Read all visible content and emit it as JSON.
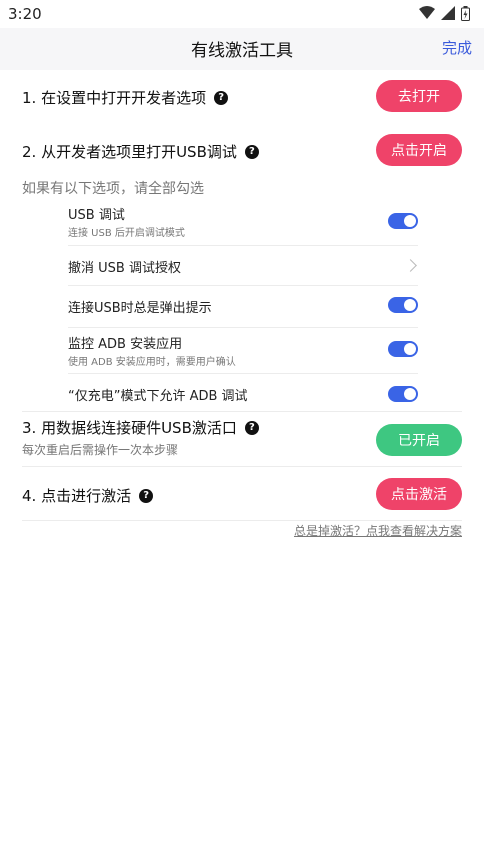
{
  "status": {
    "time": "3:20"
  },
  "header": {
    "title": "有线激活工具",
    "done_label": "完成"
  },
  "steps": [
    {
      "label": "1. 在设置中打开开发者选项",
      "button": "去打开"
    },
    {
      "label": "2. 从开发者选项里打开USB调试",
      "button": "点击开启"
    },
    {
      "label": "3. 用数据线连接硬件USB激活口",
      "sub": "每次重启后需操作一次本步骤",
      "button": "已开启"
    },
    {
      "label": "4. 点击进行激活",
      "button": "点击激活"
    }
  ],
  "hint": "如果有以下选项，请全部勾选",
  "options": [
    {
      "label": "USB 调试",
      "desc": "连接 USB 后开启调试模式",
      "control": "toggle-on"
    },
    {
      "label": "撤消 USB 调试授权",
      "control": "chevron"
    },
    {
      "label": "连接USB时总是弹出提示",
      "control": "toggle-on"
    },
    {
      "label": "监控 ADB 安装应用",
      "desc": "使用 ADB 安装应用时，需要用户确认",
      "control": "toggle-on"
    },
    {
      "label": "“仅充电”模式下允许 ADB 调试",
      "control": "toggle-on"
    }
  ],
  "footer_link": "总是掉激活？点我查看解决方案",
  "colors": {
    "primary_red": "#ef4369",
    "success_green": "#3ec781",
    "toggle_blue": "#3a64e6",
    "link_blue": "#3b5bdb"
  }
}
